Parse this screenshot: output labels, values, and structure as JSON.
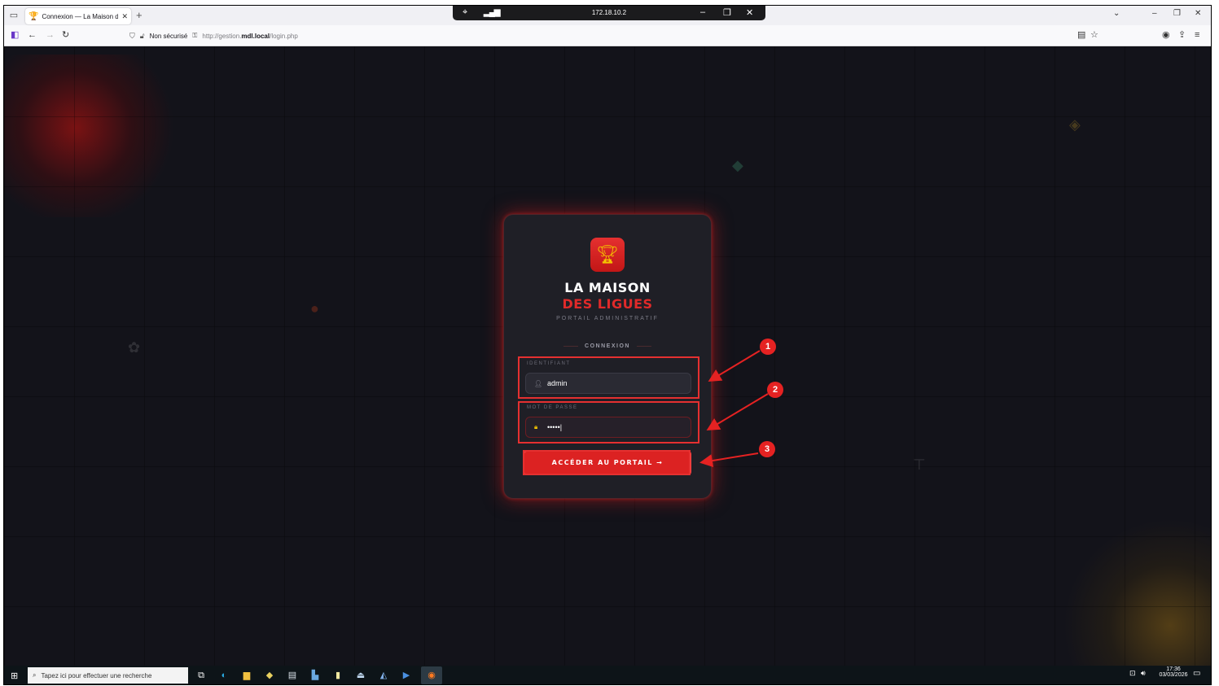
{
  "browser": {
    "tab_title": "Connexion — La Maison des Li",
    "tab_favicon": "trophy-icon",
    "new_tab": "+",
    "security_label": "Non sécurisé",
    "url_prefix": "http://gestion.",
    "url_domain": "mdl.local",
    "url_path": "/login.php"
  },
  "remote_bar": {
    "ip": "172.18.10.2"
  },
  "login": {
    "brand_line1": "LA MAISON",
    "brand_line2": "DES LIGUES",
    "subtitle": "PORTAIL ADMINISTRATIF",
    "section": "CONNEXION",
    "username_label": "IDENTIFIANT",
    "username_value": "admin",
    "password_label": "MOT DE PASSE",
    "password_value": "•••••|",
    "submit_label": "ACCÉDER AU PORTAIL →"
  },
  "annotations": [
    "1",
    "2",
    "3"
  ],
  "taskbar": {
    "search_placeholder": "Tapez ici pour effectuer une recherche",
    "time": "17:36",
    "date": "03/03/2026"
  },
  "colors": {
    "accent": "#dc2222",
    "brand_red": "#e02a2a",
    "card_bg": "#1f1f26",
    "page_bg": "#13131a"
  }
}
